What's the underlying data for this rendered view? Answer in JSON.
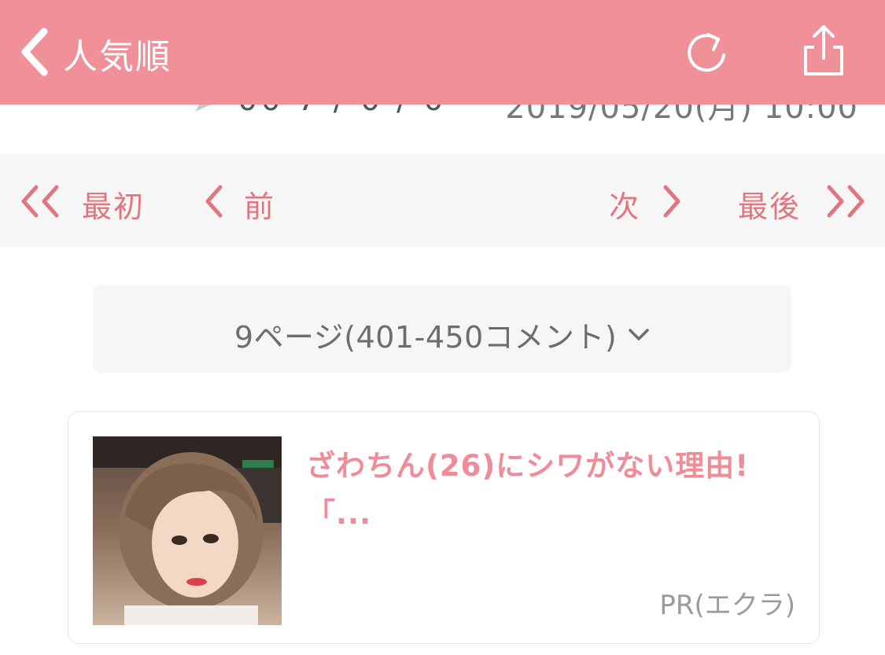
{
  "header": {
    "title": "人気順",
    "back_icon": "chevron-left-icon",
    "reload_icon": "reload-icon",
    "share_icon": "share-icon",
    "background": "#f09099"
  },
  "partial_row": {
    "username": "00 7 / 0 / 0",
    "datetime": "2019/05/20(月) 10:00"
  },
  "pager": {
    "first": "最初",
    "prev": "前",
    "next": "次",
    "last": "最後",
    "accent": "#e2767f"
  },
  "page_select": {
    "label": "9ページ(401-450コメント)",
    "icon": "chevron-down-icon"
  },
  "ad": {
    "title": "ざわちん(26)にシワがない理由!「...",
    "source": "PR(エクラ)",
    "title_color": "#ef8c98"
  }
}
